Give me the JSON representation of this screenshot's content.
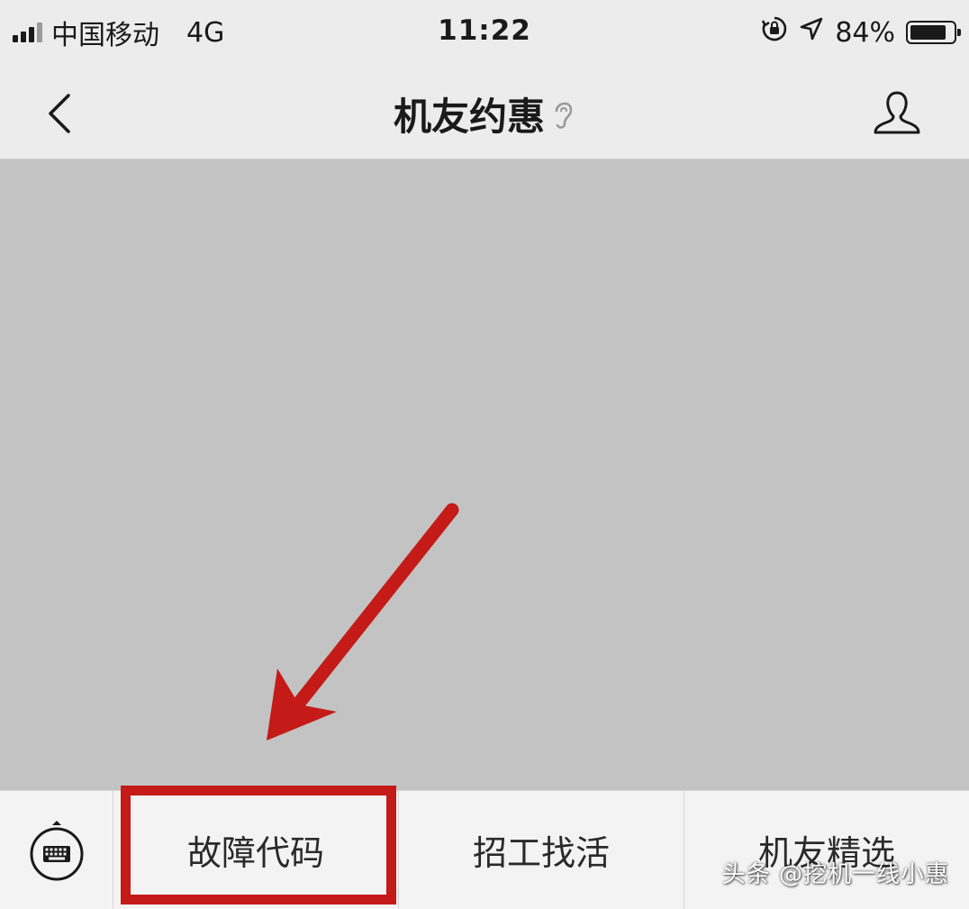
{
  "status_bar": {
    "carrier": "中国移动",
    "network": "4G",
    "time": "11:22",
    "battery_percent": "84%",
    "battery_level": 0.84,
    "icons": [
      "signal-icon",
      "orientation-lock-icon",
      "location-icon",
      "battery-icon"
    ]
  },
  "nav_bar": {
    "title": "机友约惠",
    "icons": [
      "back-chevron-icon",
      "earpiece-icon",
      "profile-icon"
    ]
  },
  "bottom_menu": {
    "items": [
      {
        "label": "故障代码"
      },
      {
        "label": "招工找活"
      },
      {
        "label": "机友精选"
      }
    ]
  },
  "annotation": {
    "color": "#c41b18"
  },
  "watermark": "头条 @挖机一线小惠"
}
